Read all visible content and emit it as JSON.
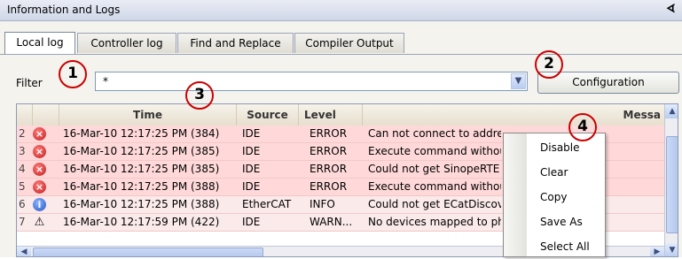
{
  "window": {
    "title": "Information and Logs",
    "pin_glyph": "ё"
  },
  "tabs": [
    "Local log",
    "Controller log",
    "Find and Replace",
    "Compiler Output"
  ],
  "filter": {
    "label": "Filter",
    "value": "*"
  },
  "config_button": "Configuration",
  "callouts": [
    "1",
    "2",
    "3",
    "4"
  ],
  "columns": [
    "Time",
    "Source",
    "Level",
    "Messa"
  ],
  "rows": [
    {
      "num": "2",
      "icon": "error-icon",
      "time": "16-Mar-10 12:17:25 PM (384)",
      "source": "IDE",
      "level": "ERROR",
      "message": "Can not connect to addre"
    },
    {
      "num": "3",
      "icon": "error-icon",
      "time": "16-Mar-10 12:17:25 PM (385)",
      "source": "IDE",
      "level": "ERROR",
      "message": "Execute command withou"
    },
    {
      "num": "4",
      "icon": "error-icon",
      "time": "16-Mar-10 12:17:25 PM (385)",
      "source": "IDE",
      "level": "ERROR",
      "message": "Could not get SinopeRTE"
    },
    {
      "num": "5",
      "icon": "error-icon",
      "time": "16-Mar-10 12:17:25 PM (388)",
      "source": "IDE",
      "level": "ERROR",
      "message": "Execute command withou"
    },
    {
      "num": "6",
      "icon": "info-icon",
      "time": "16-Mar-10 12:17:25 PM (388)",
      "source": "EtherCAT",
      "level": "INFO",
      "message": "Could not get ECatDiscov"
    },
    {
      "num": "7",
      "icon": "warning-icon",
      "time": "16-Mar-10 12:17:59 PM (422)",
      "source": "IDE",
      "level": "WARN...",
      "message": "No devices mapped to ph"
    }
  ],
  "context_menu": [
    "Disable",
    "Clear",
    "Copy",
    "Save As",
    "Select All"
  ]
}
